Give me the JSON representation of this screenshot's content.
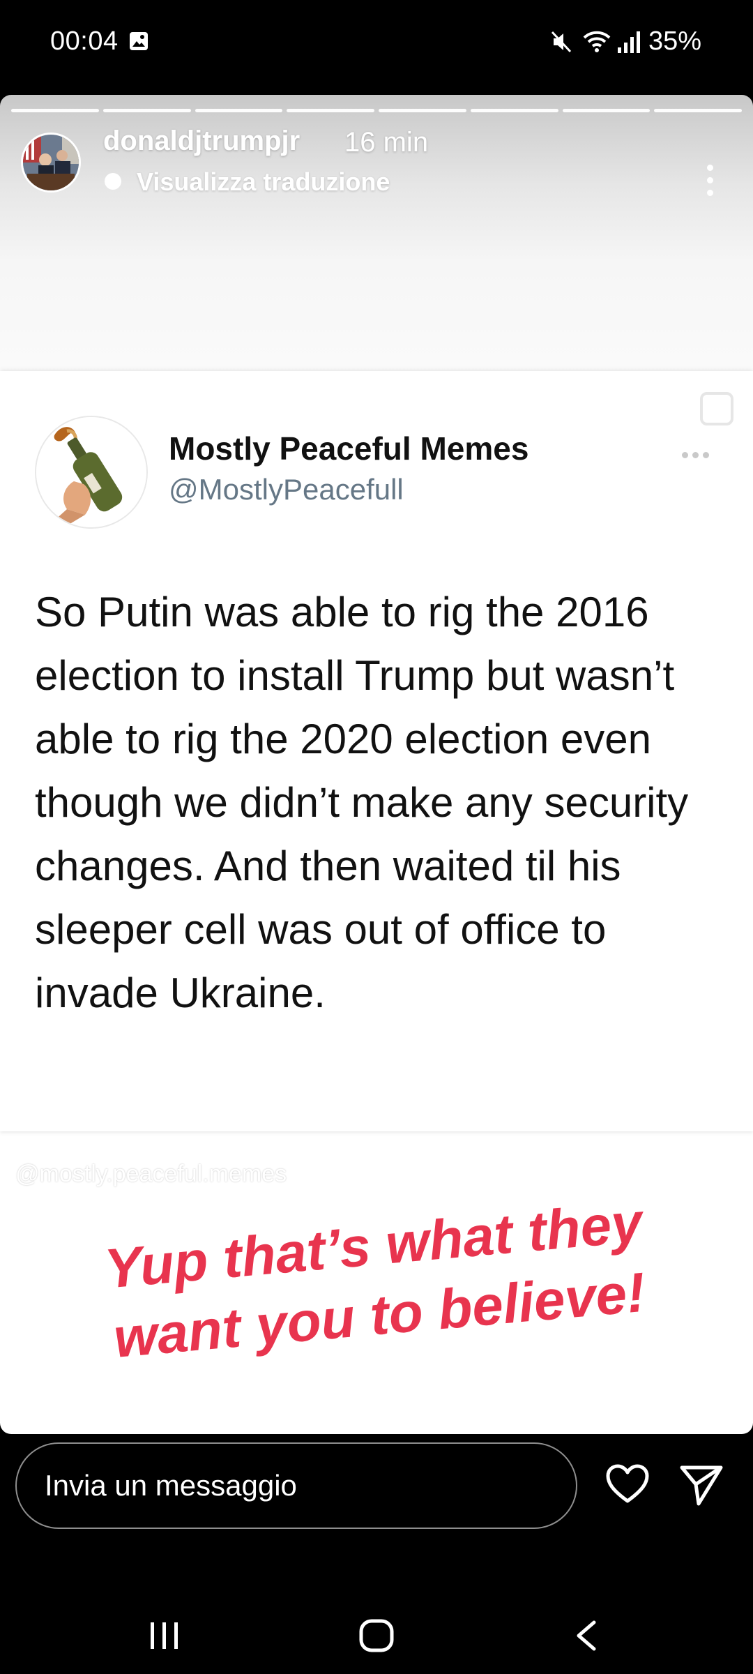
{
  "status_bar": {
    "time": "00:04",
    "battery": "35%",
    "icons": [
      "gallery-icon",
      "mute-icon",
      "wifi-icon",
      "signal-icon"
    ]
  },
  "story": {
    "username": "donaldjtrumpjr",
    "time_ago": "16 min",
    "translate_label": "Visualizza traduzione",
    "segments": 8,
    "active_segment": 8
  },
  "tweet": {
    "display_name": "Mostly Peaceful Memes",
    "handle": "@MostlyPeacefull",
    "text": "So Putin was able to rig the 2016 election to install Trump but wasn’t able to rig the 2020 election even though we didn’t make any security changes. And then waited til his sleeper cell was out of office to invade Ukraine."
  },
  "watermark": "@mostly.peaceful.memes",
  "caption": {
    "line1": "Yup that’s what they",
    "line2": "want you to believe!",
    "color": "#e8344e"
  },
  "reply_bar": {
    "placeholder": "Invia un messaggio"
  },
  "nav_bar": {
    "icons": [
      "recent-apps-icon",
      "home-icon",
      "back-icon"
    ]
  }
}
